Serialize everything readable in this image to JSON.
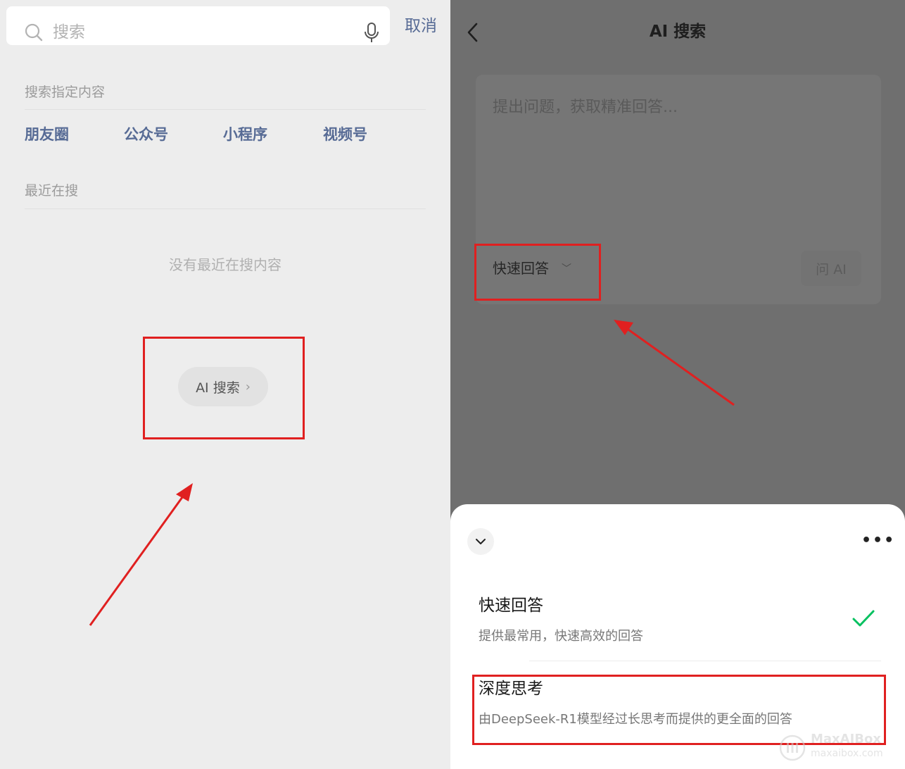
{
  "left": {
    "search": {
      "placeholder": "搜索",
      "cancel": "取消"
    },
    "section_specific": "搜索指定内容",
    "categories": [
      "朋友圈",
      "公众号",
      "小程序",
      "视频号"
    ],
    "section_recent": "最近在搜",
    "empty_recent": "没有最近在搜内容",
    "ai_search_button": "AI 搜索"
  },
  "right": {
    "title": "AI 搜索",
    "question_placeholder": "提出问题，获取精准回答...",
    "mode_label": "快速回答",
    "ask_button": "问 AI",
    "sheet": {
      "options": [
        {
          "title": "快速回答",
          "desc": "提供最常用，快速高效的回答",
          "selected": true
        },
        {
          "title": "深度思考",
          "desc": "由DeepSeek-R1模型经过长思考而提供的更全面的回答",
          "selected": false
        }
      ]
    }
  },
  "watermark": {
    "name": "MaxAIBox",
    "url": "maxaibox.com"
  },
  "colors": {
    "link_blue": "#576b95",
    "highlight_red": "#e02020",
    "check_green": "#07c160",
    "overlay_gray": "#6f6f6f"
  },
  "icons": [
    "search-icon",
    "microphone-icon",
    "chevron-right-icon",
    "back-arrow-icon",
    "chevron-down-icon",
    "more-dots-icon",
    "checkmark-icon"
  ]
}
